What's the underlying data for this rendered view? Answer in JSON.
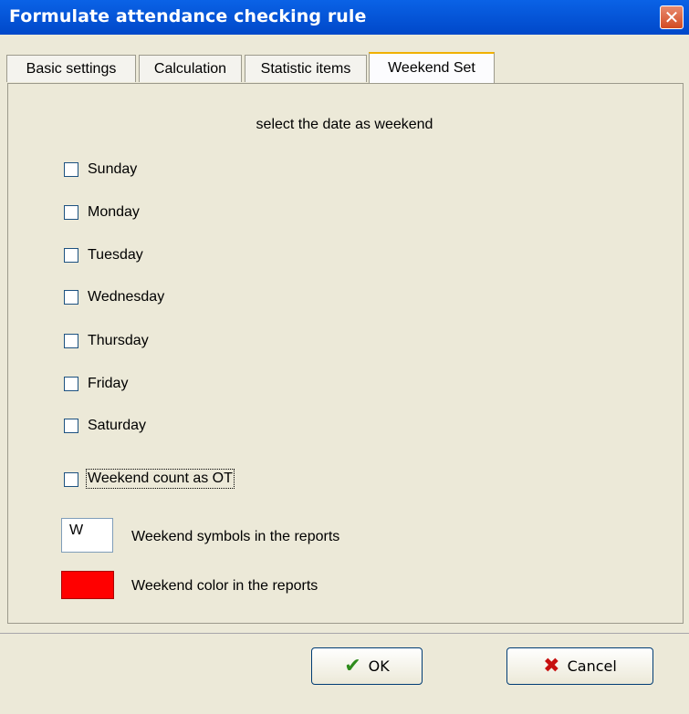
{
  "window": {
    "title": "Formulate attendance checking rule",
    "close_icon": "close-icon"
  },
  "tabs": [
    {
      "label": "Basic settings",
      "active": false
    },
    {
      "label": "Calculation",
      "active": false
    },
    {
      "label": "Statistic items",
      "active": false
    },
    {
      "label": "Weekend Set",
      "active": true
    }
  ],
  "panel": {
    "heading": "select the date as weekend",
    "days": [
      {
        "label": "Sunday",
        "checked": false
      },
      {
        "label": "Monday",
        "checked": false
      },
      {
        "label": "Tuesday",
        "checked": false
      },
      {
        "label": "Wednesday",
        "checked": false
      },
      {
        "label": "Thursday",
        "checked": false
      },
      {
        "label": "Friday",
        "checked": false
      },
      {
        "label": "Saturday",
        "checked": false
      }
    ],
    "ot_option": {
      "label": "Weekend count as OT",
      "checked": false
    },
    "symbol": {
      "value": "W",
      "label": "Weekend symbols in the reports"
    },
    "color": {
      "value": "#ff0000",
      "label": "Weekend color in the reports"
    }
  },
  "buttons": {
    "ok": "OK",
    "cancel": "Cancel"
  }
}
